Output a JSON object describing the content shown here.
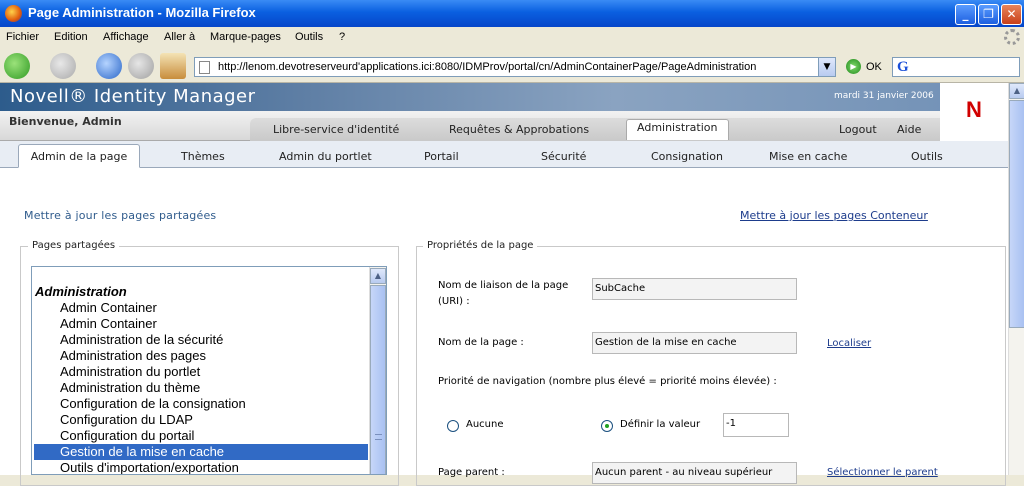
{
  "window": {
    "title": "Page Administration - Mozilla Firefox"
  },
  "menu": {
    "items": [
      "Fichier",
      "Edition",
      "Affichage",
      "Aller à",
      "Marque-pages",
      "Outils",
      "?"
    ]
  },
  "address": {
    "url": "http://lenom.devotreserveurd'applications.ici:8080/IDMProv/portal/cn/AdminContainerPage/PageAdministration",
    "go_label": "OK"
  },
  "search": {
    "engine_glyph": "G"
  },
  "banner": {
    "brand": "Novell® Identity Manager",
    "date": "mardi 31 janvier 2006",
    "logo": "N"
  },
  "header": {
    "welcome": "Bienvenue, Admin"
  },
  "main_tabs": [
    {
      "label": "Libre-service d'identité"
    },
    {
      "label": "Requêtes & Approbations"
    },
    {
      "label": "Administration",
      "active": true
    },
    {
      "label": "Logout"
    },
    {
      "label": "Aide"
    }
  ],
  "sub_tabs": [
    {
      "label": "Admin de la page",
      "active": true
    },
    {
      "label": "Thèmes"
    },
    {
      "label": "Admin du portlet"
    },
    {
      "label": "Portail"
    },
    {
      "label": "Sécurité"
    },
    {
      "label": "Consignation"
    },
    {
      "label": "Mise en cache"
    },
    {
      "label": "Outils"
    }
  ],
  "content": {
    "update_shared": "Mettre à jour les pages partagées",
    "update_container": "Mettre à jour les pages Conteneur",
    "shared_pages": {
      "legend": "Pages partagées",
      "group": "Administration",
      "items": [
        "Admin Container",
        "Admin Container",
        "Administration de la sécurité",
        "Administration des pages",
        "Administration du portlet",
        "Administration du thème",
        "Configuration de la consignation",
        "Configuration du LDAP",
        "Configuration du portail",
        "Gestion de la mise en cache",
        "Outils d'importation/exportation"
      ],
      "selected_index": 9
    },
    "properties": {
      "legend": "Propriétés de la page",
      "uri_label_1": "Nom de liaison de la page",
      "uri_label_2": "(URI) :",
      "uri_value": "SubCache",
      "name_label": "Nom de la page :",
      "name_value": "Gestion de la mise en cache",
      "localize": "Localiser",
      "priority_label": "Priorité de navigation (nombre plus élevé = priorité moins élevée) :",
      "radio_none": "Aucune",
      "radio_value": "Définir la valeur",
      "priority_value": "-1",
      "parent_label": "Page parent :",
      "parent_value": "Aucun parent - au niveau supérieur",
      "select_parent": "Sélectionner le parent"
    }
  }
}
